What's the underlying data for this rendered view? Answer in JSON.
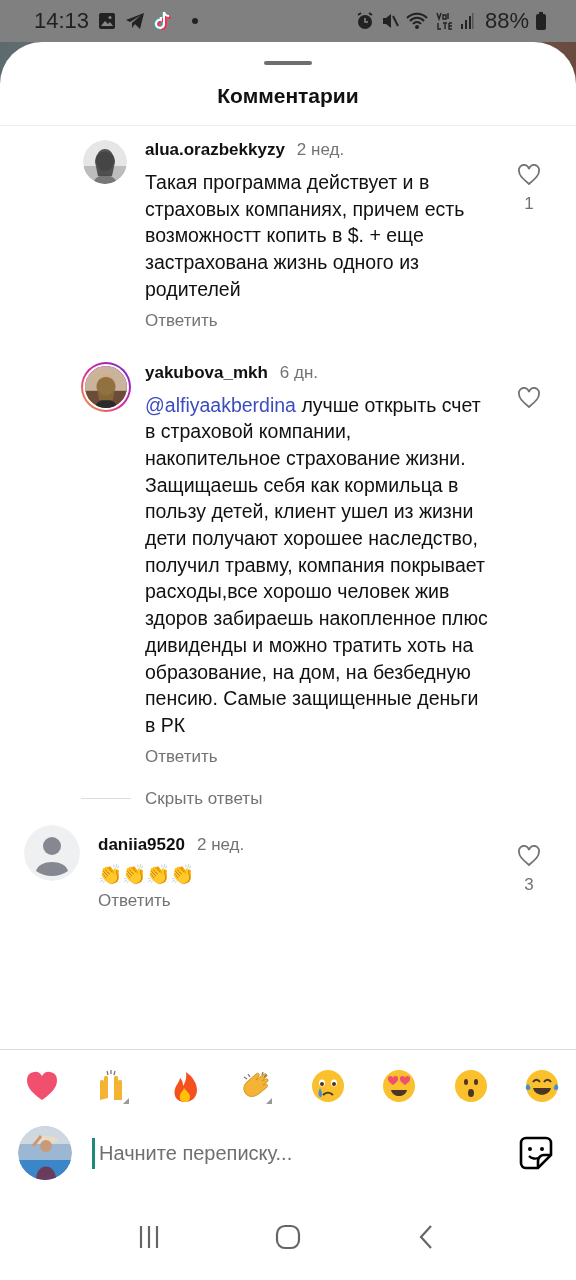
{
  "status_bar": {
    "time": "14:13",
    "battery": "88%"
  },
  "sheet": {
    "title": "Комментарии"
  },
  "replies": [
    {
      "username": "alua.orazbekkyzy",
      "time": "2 нед.",
      "story_ring": false,
      "text": "Такая программа действует и в страховых компаниях, причем есть возможностт копить в $. + еще застрахована жизнь одного из родителей",
      "reply_label": "Ответить",
      "liked": false,
      "likes": "1"
    },
    {
      "username": "yakubova_mkh",
      "time": "6 дн.",
      "story_ring": true,
      "mention": "@alfiyaakberdina",
      "text": "лучше открыть счет в страховой компании, накопительное страхование жизни. Защищаешь себя как кормильца в пользу детей, клиент ушел из жизни дети получают хорошее наследство, получил травму, компания покрывает расходы,все хорошо человек жив здоров забираешь накопленное плюс дивиденды и можно тратить хоть на образование, на дом, на безбедную пенсию. Самые защищенные деньги в РК",
      "reply_label": "Ответить",
      "liked": false
    }
  ],
  "hide_replies": "Скрыть ответы",
  "comments": [
    {
      "username": "daniia9520",
      "time": "2 нед.",
      "kind": "default",
      "story_ring": false,
      "text": "👏👏👏👏",
      "reply_label": "Ответить",
      "liked": false,
      "likes": "3"
    }
  ],
  "composer": {
    "placeholder": "Начните переписку..."
  }
}
